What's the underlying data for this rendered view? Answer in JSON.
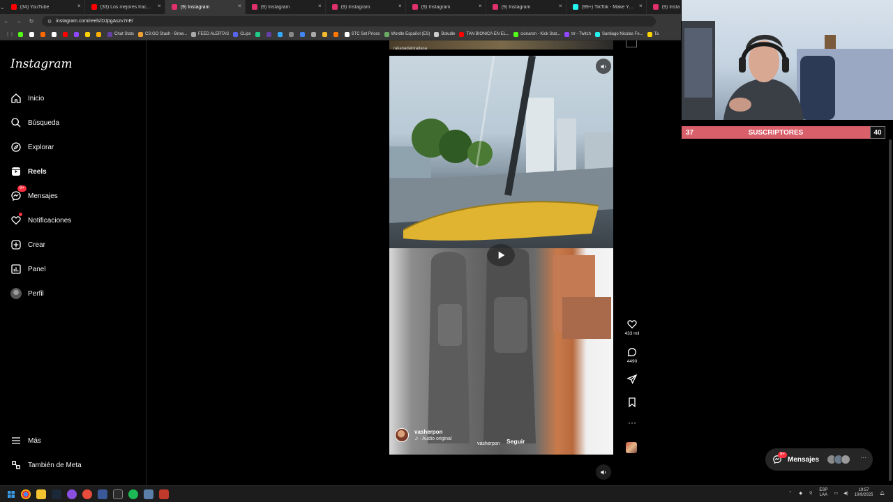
{
  "browser": {
    "tabs": [
      {
        "title": "(34) YouTube",
        "color": "#ff0000",
        "active": false
      },
      {
        "title": "(33) Los mejores fracasos vira",
        "color": "#ff0000",
        "active": false
      },
      {
        "title": "(9) Instagram",
        "color": "#e1306c",
        "active": true
      },
      {
        "title": "(9) Instagram",
        "color": "#e1306c",
        "active": false
      },
      {
        "title": "(9) Instagram",
        "color": "#e1306c",
        "active": false
      },
      {
        "title": "(9) Instagram",
        "color": "#e1306c",
        "active": false
      },
      {
        "title": "(9) Instagram",
        "color": "#e1306c",
        "active": false
      },
      {
        "title": "(99+) TikTok - Make Your Day",
        "color": "#25f4ee",
        "active": false
      },
      {
        "title": "(9) Insta",
        "color": "#e1306c",
        "active": false
      }
    ],
    "url": "instagram.com/reels/DJpgAszv7nE/",
    "bookmarks": [
      {
        "label": "",
        "color": "#53fc18"
      },
      {
        "label": "",
        "color": "#ffffff"
      },
      {
        "label": "",
        "color": "#ff6a00"
      },
      {
        "label": "",
        "color": "#ffffff"
      },
      {
        "label": "",
        "color": "#ff0000"
      },
      {
        "label": "",
        "color": "#9146ff"
      },
      {
        "label": "",
        "color": "#ffd400"
      },
      {
        "label": "",
        "color": "#ffb000"
      },
      {
        "label": "Chat Stats",
        "color": "#6441a5"
      },
      {
        "label": "CS:GO Stash - Brow...",
        "color": "#f0a030"
      },
      {
        "label": "FEED ALERTAS",
        "color": "#aaaaaa"
      },
      {
        "label": "CLips",
        "color": "#5865f2"
      },
      {
        "label": "",
        "color": "#22cc88"
      },
      {
        "label": "",
        "color": "#6441a5"
      },
      {
        "label": "",
        "color": "#33aaff"
      },
      {
        "label": "",
        "color": "#888888"
      },
      {
        "label": "",
        "color": "#4285f4"
      },
      {
        "label": "",
        "color": "#aaaaaa"
      },
      {
        "label": "",
        "color": "#f3ba2f"
      },
      {
        "label": "",
        "color": "#ff7700"
      },
      {
        "label": "STC Set Prices",
        "color": "#ffffff"
      },
      {
        "label": "Wordle Español (ES)",
        "color": "#6aaa64"
      },
      {
        "label": "Boludle",
        "color": "#cccccc"
      },
      {
        "label": "TAN BIONICA EN EL...",
        "color": "#ff0000"
      },
      {
        "label": "cionaron - Kick Stat...",
        "color": "#53fc18"
      },
      {
        "label": "trr - Twitch",
        "color": "#9146ff"
      },
      {
        "label": "Santiago Nicolas Fe...",
        "color": "#25f4ee"
      },
      {
        "label": "Ta",
        "color": "#ffd400"
      }
    ]
  },
  "instagram": {
    "logo": "Instagram",
    "nav": [
      {
        "key": "inicio",
        "label": "Inicio"
      },
      {
        "key": "busqueda",
        "label": "Búsqueda"
      },
      {
        "key": "explorar",
        "label": "Explorar"
      },
      {
        "key": "reels",
        "label": "Reels"
      },
      {
        "key": "mensajes",
        "label": "Mensajes",
        "badge": "9+"
      },
      {
        "key": "notificaciones",
        "label": "Notificaciones"
      },
      {
        "key": "crear",
        "label": "Crear"
      },
      {
        "key": "panel",
        "label": "Panel"
      },
      {
        "key": "perfil",
        "label": "Perfil"
      }
    ],
    "bottom_nav": [
      {
        "key": "mas",
        "label": "Más"
      },
      {
        "key": "meta",
        "label": "También de Meta"
      }
    ],
    "reel": {
      "top_caption": "rakanadaloradasa",
      "author": "vasherpon",
      "audio": "· Audio original",
      "audio_user": "vasherpon",
      "follow": "Seguir",
      "likes": "433 mil",
      "comments": "4490"
    },
    "messages_pill": {
      "label": "Mensajes",
      "badge": "9+"
    }
  },
  "stream_overlay": {
    "subs_current": "37",
    "subs_label": "SUSCRIPTORES",
    "subs_goal": "40",
    "bar_color": "#d95f6a"
  },
  "taskbar": {
    "lang_top": "ESP",
    "lang_bottom": "LAA",
    "time": "19:57",
    "date": "10/9/2025"
  }
}
